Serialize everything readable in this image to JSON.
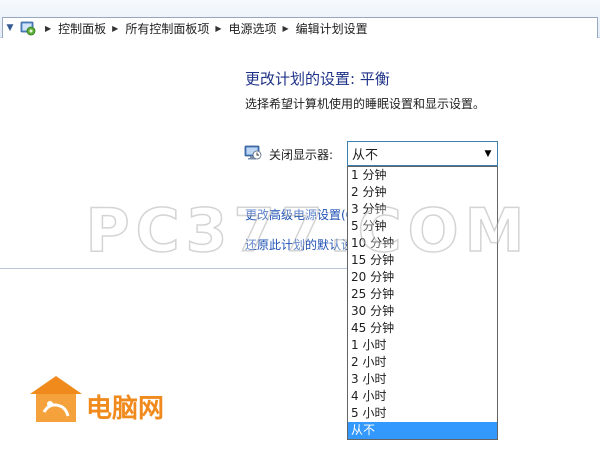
{
  "breadcrumbs": [
    "控制面板",
    "所有控制面板项",
    "电源选项",
    "编辑计划设置"
  ],
  "page": {
    "title": "更改计划的设置: 平衡",
    "subtitle": "选择希望计算机使用的睡眠设置和显示设置。"
  },
  "display_setting": {
    "label": "关闭显示器:",
    "selected": "从不",
    "options": [
      "1 分钟",
      "2 分钟",
      "3 分钟",
      "5 分钟",
      "10 分钟",
      "15 分钟",
      "20 分钟",
      "25 分钟",
      "30 分钟",
      "45 分钟",
      "1 小时",
      "2 小时",
      "3 小时",
      "4 小时",
      "5 小时",
      "从不"
    ],
    "highlighted_index": 15
  },
  "links": {
    "advanced": "更改高级电源设置(C)",
    "restore": "还原此计划的默认设置"
  },
  "watermark": {
    "text": "PC377.COM",
    "logo_text": "电脑网"
  },
  "colors": {
    "title": "#1e3287",
    "link": "#1e50b4",
    "selection": "#3399ff",
    "logo": "#f08a1c"
  }
}
